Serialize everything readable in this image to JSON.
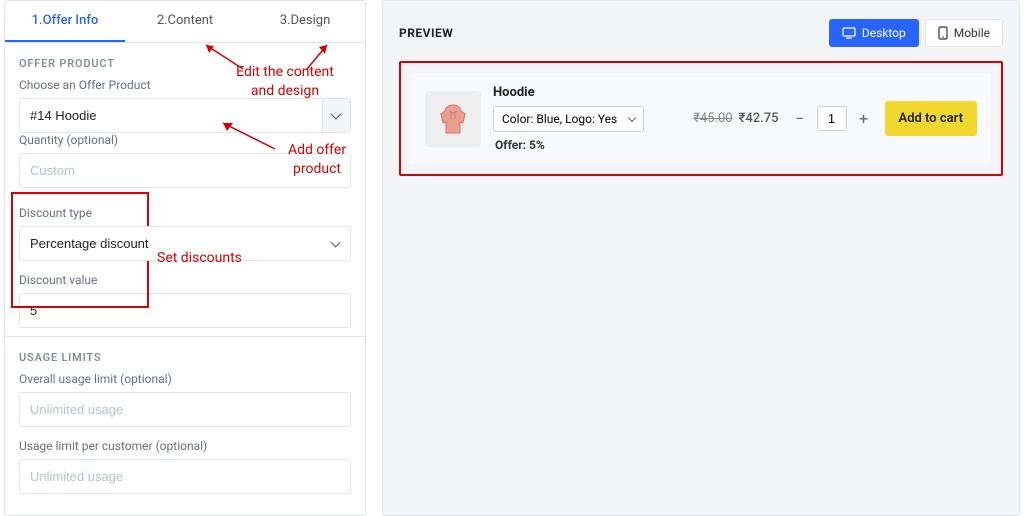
{
  "tabs": {
    "offer_info": "1.Offer Info",
    "content": "2.Content",
    "design": "3.Design"
  },
  "offer_product": {
    "title": "OFFER PRODUCT",
    "choose_label": "Choose an Offer Product",
    "value": "#14 Hoodie",
    "qty_label": "Quantity (optional)",
    "qty_placeholder": "Custom"
  },
  "discount": {
    "type_label": "Discount type",
    "type_value": "Percentage discount",
    "value_label": "Discount value",
    "value": "5"
  },
  "usage": {
    "title": "USAGE LIMITS",
    "overall_label": "Overall usage limit (optional)",
    "overall_placeholder": "Unlimited usage",
    "percust_label": "Usage limit per customer (optional)",
    "percust_placeholder": "Unlimited usage"
  },
  "annotations": {
    "content_design": "Edit the content\nand design",
    "add_offer": "Add offer\nproduct",
    "set_discounts": "Set discounts"
  },
  "preview": {
    "title": "PREVIEW",
    "desktop": "Desktop",
    "mobile": "Mobile",
    "product_title": "Hoodie",
    "variant": "Color: Blue, Logo: Yes",
    "offer_note": "Offer: 5%",
    "price_old": "₹45.00",
    "price_new": "₹42.75",
    "qty": "1",
    "add_to_cart": "Add to cart"
  }
}
